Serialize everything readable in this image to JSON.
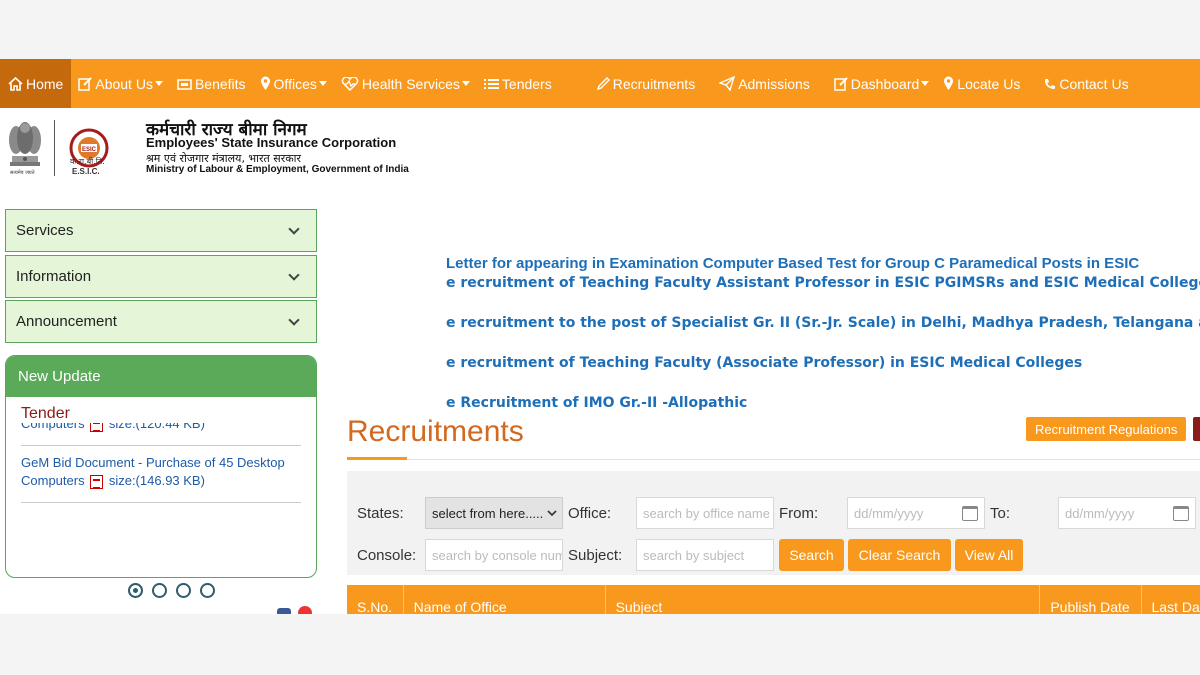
{
  "nav": {
    "items": [
      {
        "label": "Home",
        "icon": "home-icon",
        "dropdown": false
      },
      {
        "label": "About Us",
        "icon": "edit-icon",
        "dropdown": true
      },
      {
        "label": "Benefits",
        "icon": "wallet-icon",
        "dropdown": false
      },
      {
        "label": "Offices",
        "icon": "map-marker-icon",
        "dropdown": true
      },
      {
        "label": "Health Services",
        "icon": "heartbeat-icon",
        "dropdown": true
      },
      {
        "label": "Tenders",
        "icon": "list-icon",
        "dropdown": false
      },
      {
        "label": "Recruitments",
        "icon": "pencil-icon",
        "dropdown": false
      },
      {
        "label": "Admissions",
        "icon": "paper-plane-icon",
        "dropdown": false
      },
      {
        "label": "Dashboard",
        "icon": "edit-icon",
        "dropdown": true
      },
      {
        "label": "Locate Us",
        "icon": "map-marker-icon",
        "dropdown": false
      },
      {
        "label": "Contact Us",
        "icon": "phone-icon",
        "dropdown": false
      }
    ],
    "active_color": "#c46a0c",
    "bar_color": "#f8981d"
  },
  "header": {
    "org_hindi": "कर्मचारी राज्य बीमा निगम",
    "org_english": "Employees' State Insurance Corporation",
    "ministry_hindi": "श्रम एवं रोजगार मंत्रालय, भारत सरकार",
    "ministry_english": "Ministry of Labour & Employment, Government of India",
    "logo_hindi": "क.रा.बी.नि.",
    "logo_english": "E.S.I.C.",
    "emblem_caption": "सत्यमेव जयते"
  },
  "sidebar": {
    "accordion": [
      "Services",
      "Information",
      "Announcement"
    ],
    "new_update": {
      "title": "New Update",
      "section": "Tender",
      "items": [
        {
          "text": "Computers",
          "size": "size:(120.44 KB)"
        },
        {
          "text": "GeM Bid Document - Purchase of 45 Desktop Computers",
          "size": "size:(146.93 KB)"
        }
      ]
    },
    "carousel_dots": 4,
    "carousel_active": 1
  },
  "marquee": [
    "Letter for appearing in Examination Computer Based Test for Group C Paramedical Posts in ESIC",
    "e recruitment of Teaching Faculty Assistant Professor in ESIC PGIMSRs and ESIC Medical Colleges",
    "e recruitment to the post of Specialist Gr. II (Sr.-Jr. Scale) in Delhi, Madhya Pradesh, Telangana and Tamilnadu region",
    "e recruitment of Teaching Faculty (Associate Professor) in ESIC Medical Colleges",
    "e Recruitment of IMO Gr.-II -Allopathic"
  ],
  "main": {
    "title": "Recruitments",
    "regulations_button": "Recruitment Regulations"
  },
  "filters": {
    "states_label": "States:",
    "states_value": "select from here.....",
    "office_label": "Office:",
    "office_placeholder": "search by office name",
    "from_label": "From:",
    "from_placeholder": "dd/mm/yyyy",
    "to_label": "To:",
    "to_placeholder": "dd/mm/yyyy",
    "console_label": "Console:",
    "console_placeholder": "search by console number",
    "subject_label": "Subject:",
    "subject_placeholder": "search by subject",
    "search_button": "Search",
    "clear_button": "Clear Search",
    "viewall_button": "View All"
  },
  "table": {
    "columns": [
      "S.No.",
      "Name of Office",
      "Subject",
      "Publish Date",
      "Last Date"
    ]
  }
}
